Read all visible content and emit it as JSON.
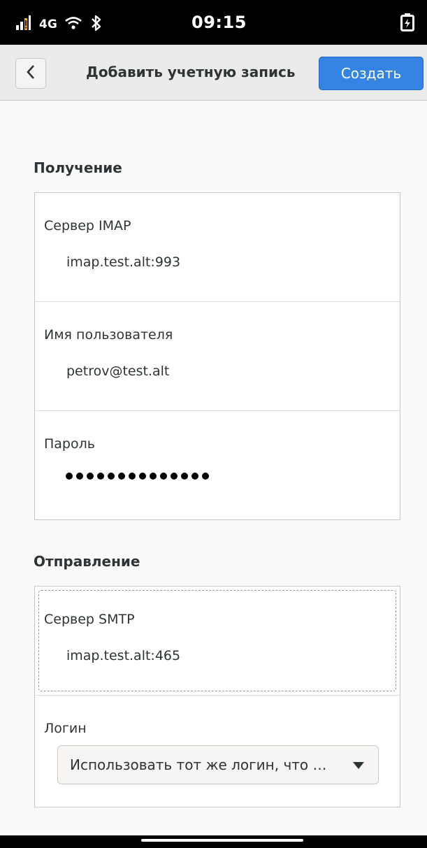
{
  "status_bar": {
    "network": "4G",
    "time": "09:15",
    "icons": [
      "signal-icon",
      "wifi-icon",
      "bluetooth-icon",
      "battery-charging-icon"
    ]
  },
  "header": {
    "title": "Добавить учетную запись",
    "back_icon": "chevron-left-icon",
    "create_label": "Создать",
    "accent_color": "#3584e4"
  },
  "receiving": {
    "section_title": "Получение",
    "server_label": "Сервер IMAP",
    "server_value": "imap.test.alt:993",
    "username_label": "Имя пользователя",
    "username_value": "petrov@test.alt",
    "password_label": "Пароль",
    "password_length": 14
  },
  "sending": {
    "section_title": "Отправление",
    "server_label": "Сервер SMTP",
    "server_value": "imap.test.alt:465",
    "login_label": "Логин",
    "login_selected": "Использовать тот же логин, что …"
  }
}
